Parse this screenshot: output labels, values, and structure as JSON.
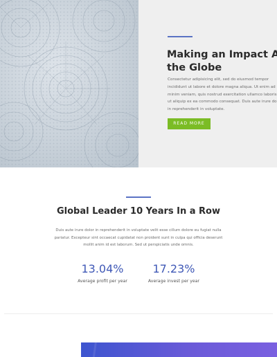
{
  "hero": {
    "title_line1": "Making an Impact Across",
    "title_line2": "the Globe",
    "body": [
      "Consectetur adipisicing elit, sed do eiusmod tempor",
      "incididunt ut labore et dolore magna aliqua. Ut enim ad",
      "minim veniam, quis nostrud exercitation ullamco laboris nisi",
      "ut aliquip ex ea commodo consequat. Duis aute irure dolor",
      "in reprehenderit in voluptate."
    ],
    "button_label": "READ MORE",
    "accent_color": "#5a72c4",
    "button_color": "#7bbc25"
  },
  "section": {
    "title_prefix": "Global Leader ",
    "title_bold": "10",
    "title_suffix": " Years In a Row",
    "body": [
      "Duis aute irure dolor in reprehenderit in voluptate velit esse cillum dolore eu fugiat nulla",
      "pariatur. Excepteur sint occaecat cupidatat non proident sunt in culpa qui officia deserunt",
      "mollit anim id est laborum. Sed ut perspiciatis unde omnis."
    ]
  },
  "stats": [
    {
      "value": "13.04%",
      "label": "Average profit per year"
    },
    {
      "value": "17.23%",
      "label": "Average invest per year"
    }
  ],
  "stat_color": "#3f58b6",
  "cta_strip_color": "#4a58d4"
}
